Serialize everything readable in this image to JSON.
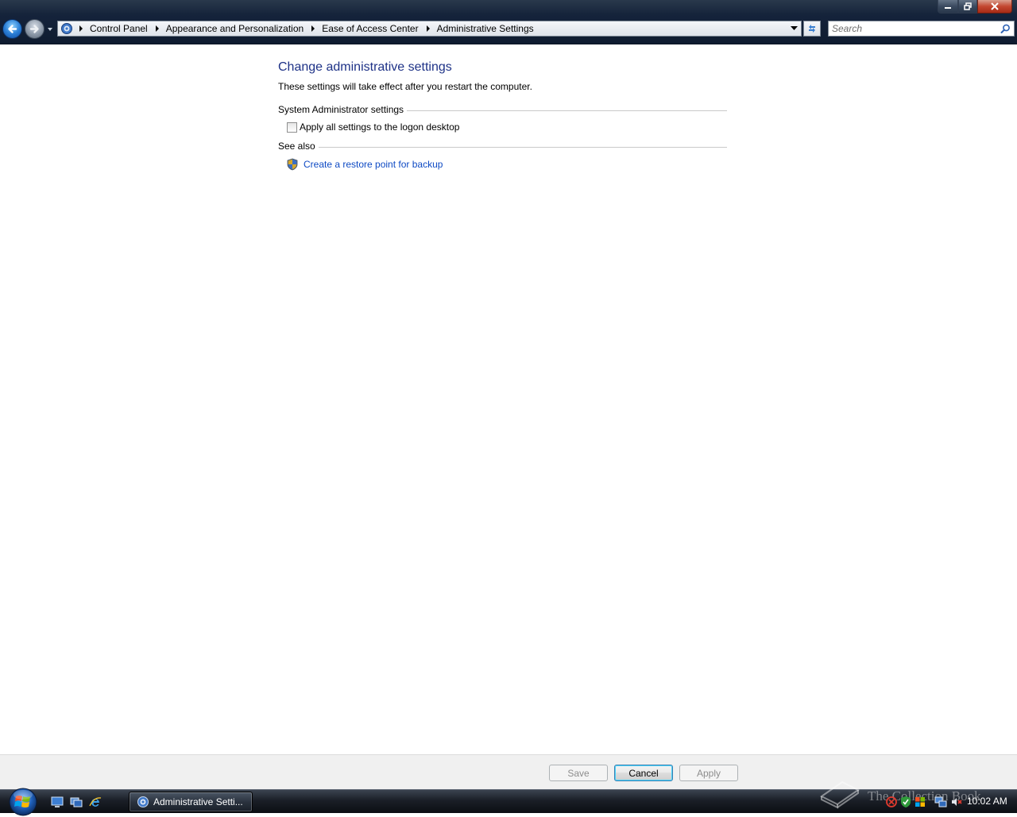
{
  "window": {
    "minimize_icon": "minimize-icon",
    "maximize_icon": "restore-icon",
    "close_icon": "close-icon"
  },
  "navigation": {
    "back_icon": "back-arrow-icon",
    "forward_icon": "forward-arrow-icon",
    "recent_pages_icon": "chevron-down-icon"
  },
  "address_bar": {
    "root_icon": "control-panel-icon",
    "breadcrumbs": [
      {
        "label": "Control Panel"
      },
      {
        "label": "Appearance and Personalization"
      },
      {
        "label": "Ease of Access Center"
      },
      {
        "label": "Administrative Settings"
      }
    ],
    "refresh_icon": "refresh-icon"
  },
  "search": {
    "placeholder": "Search",
    "value": "",
    "icon": "search-icon"
  },
  "content": {
    "title": "Change administrative settings",
    "description": "These settings will take effect after you restart the computer.",
    "admin_group": {
      "header": "System Administrator settings",
      "checkbox_label": "Apply all settings to the logon desktop",
      "checked": false
    },
    "see_also": {
      "header": "See also",
      "link_label": "Create a restore point for backup",
      "link_icon": "shield-icon"
    }
  },
  "buttons": {
    "save": {
      "label": "Save",
      "enabled": false
    },
    "cancel": {
      "label": "Cancel",
      "enabled": true
    },
    "apply": {
      "label": "Apply",
      "enabled": false
    }
  },
  "taskbar": {
    "start_icon": "windows-orb-icon",
    "quick_launch": [
      "show-desktop-icon",
      "switch-windows-icon",
      "internet-explorer-icon"
    ],
    "active_task_label": "Administrative Setti...",
    "watermark_text": "The Collection Book",
    "tray": [
      "defender-icon",
      "security-alert-icon",
      "windows-update-icon",
      "network-icon",
      "volume-muted-icon"
    ],
    "clock": "10:02 AM"
  },
  "colors": {
    "title_blue": "#1e3287",
    "link_blue": "#0e4ac4",
    "chrome_dark": "#14223a"
  }
}
